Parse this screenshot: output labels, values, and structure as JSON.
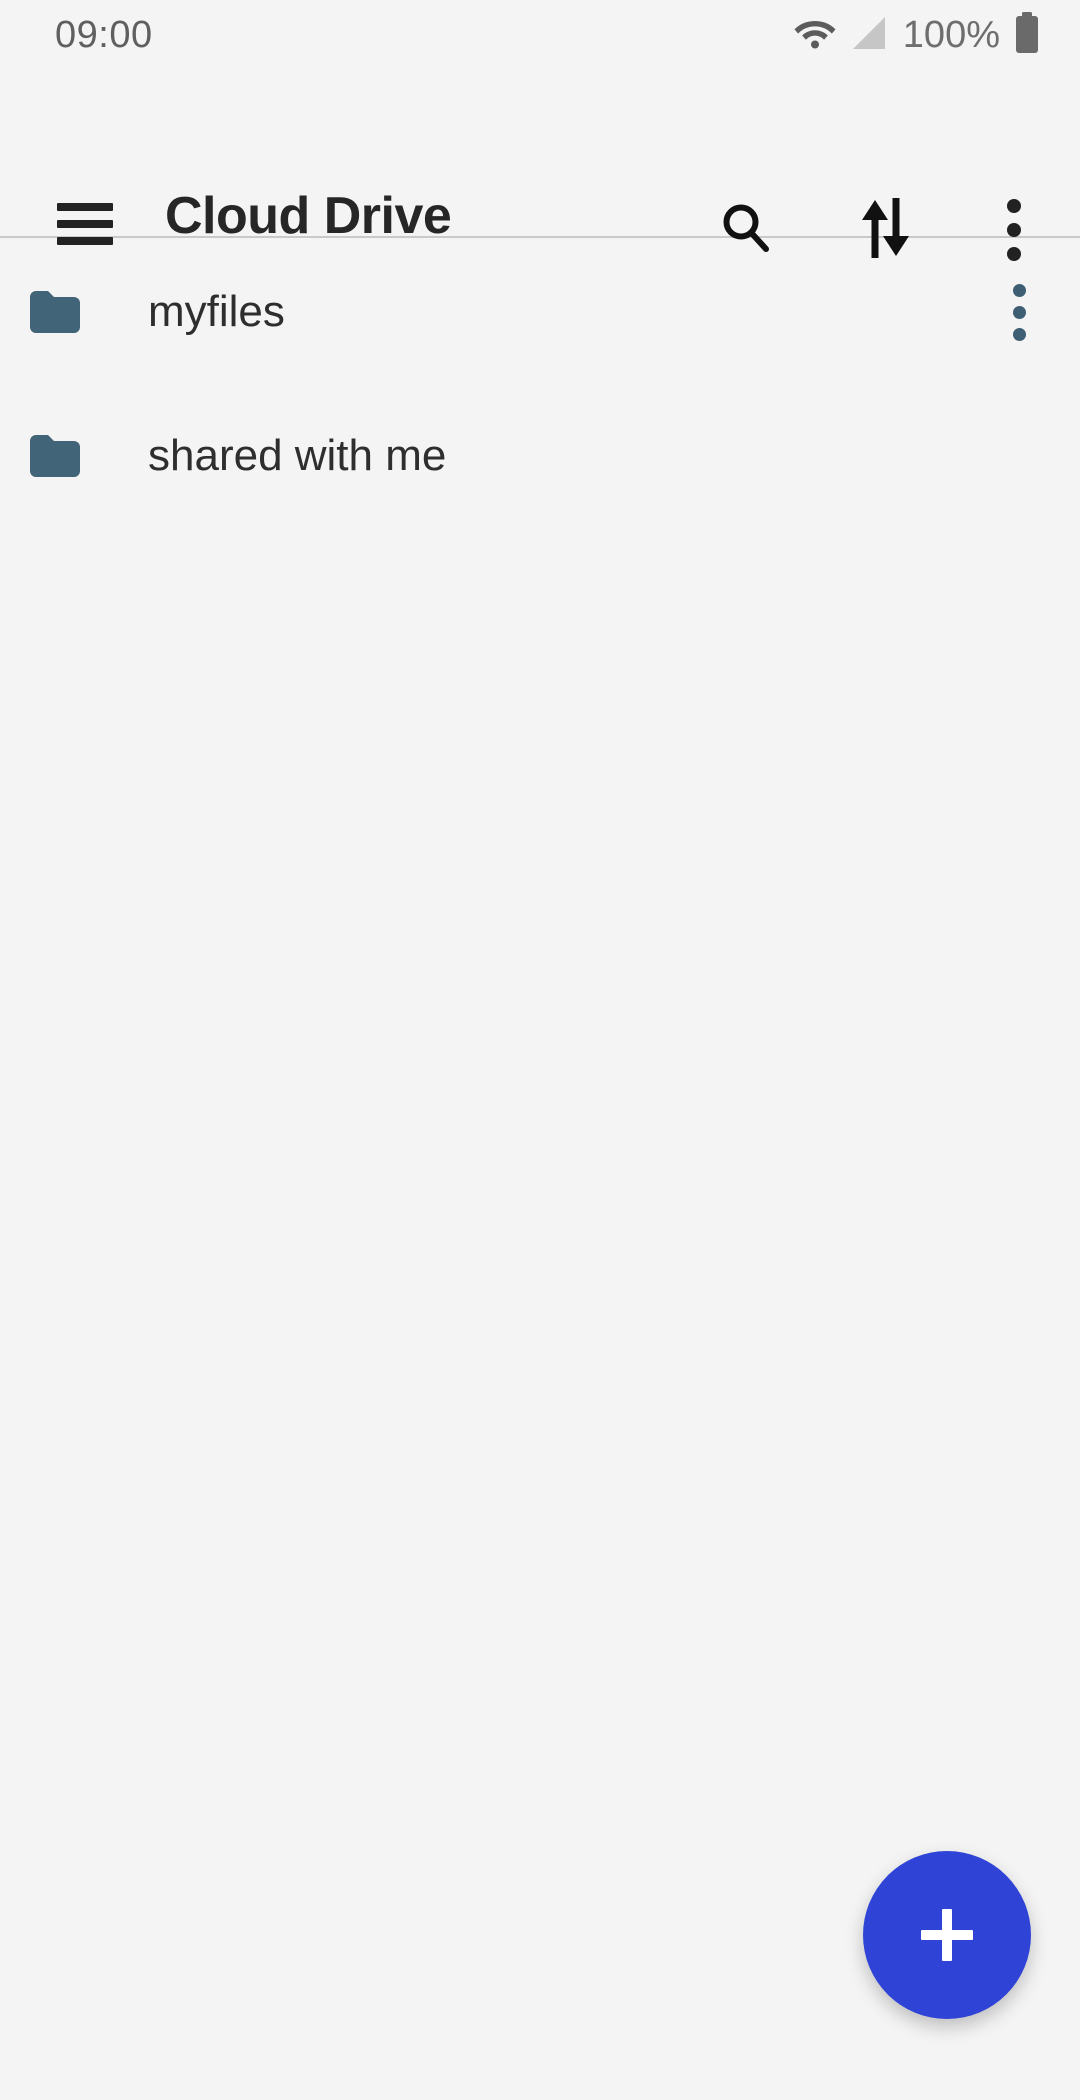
{
  "status_bar": {
    "time": "09:00",
    "battery_percent": "100%",
    "icons": {
      "wifi": "wifi-icon",
      "signal": "cellular-signal-icon",
      "battery": "battery-full-icon"
    }
  },
  "app_bar": {
    "menu_icon": "hamburger-menu-icon",
    "title": "Cloud Drive",
    "actions": [
      {
        "name": "search-icon",
        "label": "Search"
      },
      {
        "name": "sort-icon",
        "label": "Sort"
      },
      {
        "name": "overflow-menu-icon",
        "label": "More options"
      }
    ]
  },
  "file_list": {
    "items": [
      {
        "name": "myfiles",
        "type": "folder",
        "has_menu": true
      },
      {
        "name": "shared with me",
        "type": "folder",
        "has_menu": false
      }
    ]
  },
  "fab": {
    "label": "+",
    "name": "add-button"
  },
  "colors": {
    "background": "#f4f4f4",
    "folder": "#416478",
    "fab": "#2f44d6",
    "title_text": "#262626",
    "item_text": "#2e2e2e",
    "status_text": "#6e6e6e"
  }
}
